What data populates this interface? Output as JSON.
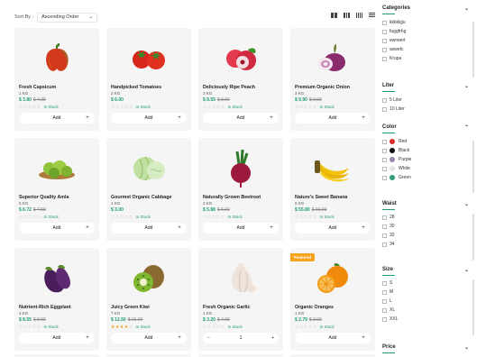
{
  "toolbar": {
    "sort_label": "Sort By :",
    "sort_value": "Ascending Order"
  },
  "products": [
    {
      "name": "Fresh Capsicum",
      "qty": "1 KG",
      "price": "$ 3.80",
      "old": "$ 4.20",
      "stars": 0,
      "stock": "In Stock",
      "action": "Add",
      "img": "capsicum"
    },
    {
      "name": "Handpicked Tomatoes",
      "qty": "2 KG",
      "price": "$ 6.00",
      "old": "",
      "stars": 0,
      "stock": "In Stock",
      "action": "Add",
      "img": "tomato"
    },
    {
      "name": "Deliciously Ripe Peach",
      "qty": "3 KG",
      "price": "$ 8.55",
      "old": "$ 9.00",
      "stars": 0,
      "stock": "In Stock",
      "action": "Add",
      "img": "peach"
    },
    {
      "name": "Premium Organic Onion",
      "qty": "3 KG",
      "price": "$ 9.90",
      "old": "$ 9.99",
      "stars": 0,
      "stock": "In Stock",
      "action": "Add",
      "img": "onion"
    },
    {
      "name": "Superior Quality Amla",
      "qty": "5 KG",
      "price": "$ 6.72",
      "old": "$ 7.50",
      "stars": 0,
      "stock": "In Stock",
      "action": "Add",
      "img": "amla"
    },
    {
      "name": "Gourmet Organic Cabbage",
      "qty": "1 KG",
      "price": "$ 3.00",
      "old": "",
      "stars": 0,
      "stock": "In Stock",
      "action": "Add",
      "img": "cabbage"
    },
    {
      "name": "Naturally Grown Beetroot",
      "qty": "2 KG",
      "price": "$ 5.88",
      "old": "$ 6.00",
      "stars": 0,
      "stock": "In Stock",
      "action": "Add",
      "img": "beetroot"
    },
    {
      "name": "Nature's Sweet Banana",
      "qty": "5 KG",
      "price": "$ 55.80",
      "old": "$ 60.00",
      "stars": 0,
      "stock": "In Stock",
      "action": "Add",
      "img": "banana"
    },
    {
      "name": "Nutrient-Rich Eggplant",
      "qty": "3 KG",
      "price": "$ 8.55",
      "old": "$ 9.00",
      "stars": 0,
      "stock": "In Stock",
      "action": "Add",
      "img": "eggplant"
    },
    {
      "name": "Juicy Green Kiwi",
      "qty": "7 KG",
      "price": "$ 12.50",
      "old": "$ 26.00",
      "stars": 4,
      "stock": "In Stock",
      "action": "Add",
      "img": "kiwi"
    },
    {
      "name": "Fresh Organic Garlic",
      "qty": "1 KG",
      "price": "$ 3.20",
      "old": "$ 4.00",
      "stars": 0,
      "stock": "In Stock",
      "action": "stepper",
      "stepper_value": "1",
      "img": "garlic"
    },
    {
      "name": "Organic Oranges",
      "qty": "1 KG",
      "price": "$ 2.79",
      "old": "$ 3.00",
      "stars": 0,
      "stock": "In Stock",
      "action": "Add",
      "img": "orange",
      "badge": "Featured"
    }
  ],
  "filters": {
    "categories": {
      "title": "Categories",
      "items": [
        "kkkkkjju",
        "fuggfrhg",
        "ewrwert",
        "aswefc",
        "Krupa"
      ]
    },
    "liter": {
      "title": "Liter",
      "items": [
        "5 Liter",
        "10 Liter"
      ]
    },
    "color": {
      "title": "Color",
      "items": [
        {
          "label": "Red",
          "hex": "#d92c2c"
        },
        {
          "label": "Black",
          "hex": "#111111"
        },
        {
          "label": "Purple",
          "hex": "#9b88b0"
        },
        {
          "label": "White",
          "hex": "#e5e5e5"
        },
        {
          "label": "Green",
          "hex": "#2c9e7a"
        }
      ]
    },
    "waist": {
      "title": "Waist",
      "items": [
        "28",
        "30",
        "32",
        "34"
      ]
    },
    "size": {
      "title": "Size",
      "items": [
        "S",
        "M",
        "L",
        "XL",
        "XXL"
      ]
    },
    "price": {
      "title": "Price"
    }
  },
  "colors": {
    "accent": "#1e9e6a",
    "star": "#f0a020",
    "badge": "#f5a31a"
  }
}
